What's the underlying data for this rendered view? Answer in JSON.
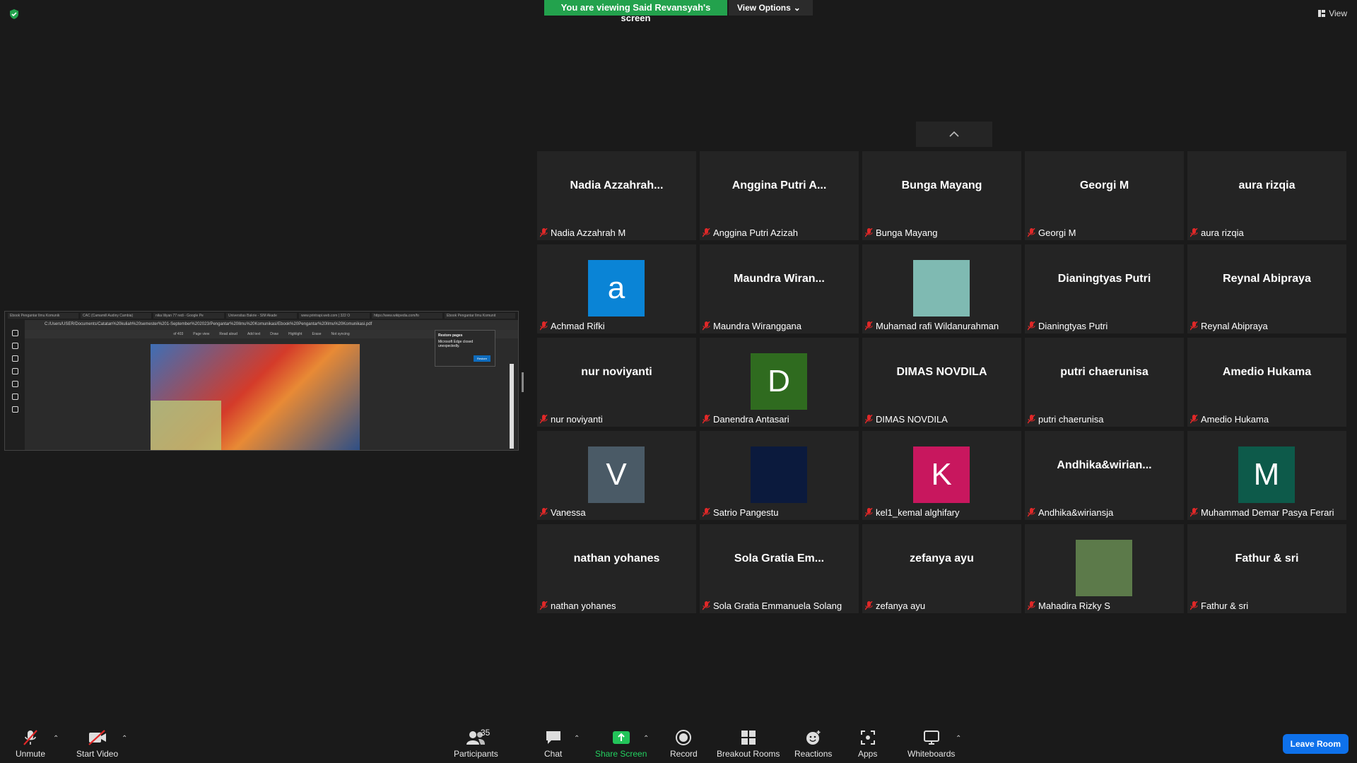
{
  "banner": {
    "viewing": "You are viewing Said Revansyah's screen",
    "view_options": "View Options"
  },
  "view_label": "View",
  "shared_screen": {
    "tabs": [
      "Ebook Pengantar Ilmu Komunik",
      "CAC (Camamill Audiny Cambia)",
      "nika liliyan 77 redi - Google Pe",
      "Universitas Bakrie - SIM Akade",
      "www.printrapi.web.com | 322 O",
      "https://www.wikipedia.com/fo",
      "Ebook Pengantar Ilmu Komunit"
    ],
    "address": "C:/Users/USER/Documents/Catatan%20kuliah%20semester%201-September%202023/Pengantar%20Ilmu%20Komunikasi/Ebook%20Pengantar%20Ilmu%20Komunikasi.pdf",
    "toolbar": [
      "Page view",
      "Read aloud",
      "Add text",
      "Draw",
      "Highlight",
      "Erase"
    ],
    "popup_title": "Restore pages",
    "popup_text": "Microsoft Edge closed unexpectedly.",
    "popup_button": "Restore",
    "not_syncing": "Not syncing",
    "page_count": "of 403"
  },
  "participants_tiles": [
    {
      "big": "Nadia  Azzahrah...",
      "name": "Nadia Azzahrah M"
    },
    {
      "big": "Anggina Putri A...",
      "name": "Anggina Putri Azizah"
    },
    {
      "big": "Bunga Mayang",
      "name": "Bunga Mayang"
    },
    {
      "big": "Georgi M",
      "name": "Georgi M"
    },
    {
      "big": "aura rizqia",
      "name": "aura rizqia"
    },
    {
      "avatar": "a",
      "color": "#0a84d6",
      "name": "Achmad Rifki"
    },
    {
      "big": "Maundra  Wiran...",
      "name": "Maundra Wiranggana"
    },
    {
      "avatar": "",
      "color": "#7fbab2",
      "name": "Muhamad rafi Wildanurahman"
    },
    {
      "big": "Dianingtyas Putri",
      "name": "Dianingtyas Putri"
    },
    {
      "big": "Reynal Abipraya",
      "name": "Reynal Abipraya"
    },
    {
      "big": "nur noviyanti",
      "name": "nur noviyanti"
    },
    {
      "avatar": "D",
      "color": "#2f6b1f",
      "name": "Danendra Antasari"
    },
    {
      "big": "DIMAS NOVDILA",
      "name": "DIMAS NOVDILA"
    },
    {
      "big": "putri chaerunisa",
      "name": "putri chaerunisa"
    },
    {
      "big": "Amedio Hukama",
      "name": "Amedio Hukama"
    },
    {
      "avatar": "V",
      "color": "#4a5a66",
      "name": "Vanessa"
    },
    {
      "avatar": "",
      "color": "#0b1a3d",
      "name": "Satrio Pangestu"
    },
    {
      "avatar": "K",
      "color": "#c8175e",
      "name": "kel1_kemal alghifary"
    },
    {
      "big": "Andhika&wirian...",
      "name": "Andhika&wiriansja"
    },
    {
      "avatar": "M",
      "color": "#0d5a4a",
      "name": "Muhammad Demar Pasya Ferari"
    },
    {
      "big": "nathan yohanes",
      "name": "nathan yohanes"
    },
    {
      "big": "Sola  Gratia  Em...",
      "name": "Sola Gratia Emmanuela Solang"
    },
    {
      "big": "zefanya ayu",
      "name": "zefanya ayu"
    },
    {
      "avatar": "",
      "color": "#5c7a4a",
      "name": "Mahadira Rizky S"
    },
    {
      "big": "Fathur & sri",
      "name": "Fathur & sri"
    }
  ],
  "toolbar": {
    "unmute": "Unmute",
    "start_video": "Start Video",
    "participants": "Participants",
    "participants_count": "35",
    "chat": "Chat",
    "share_screen": "Share Screen",
    "record": "Record",
    "breakout_rooms": "Breakout Rooms",
    "reactions": "Reactions",
    "apps": "Apps",
    "whiteboards": "Whiteboards",
    "leave": "Leave Room"
  },
  "colors": {
    "share_green": "#23a24d",
    "leave_blue": "#0e71eb",
    "muted_red": "#e02828"
  }
}
